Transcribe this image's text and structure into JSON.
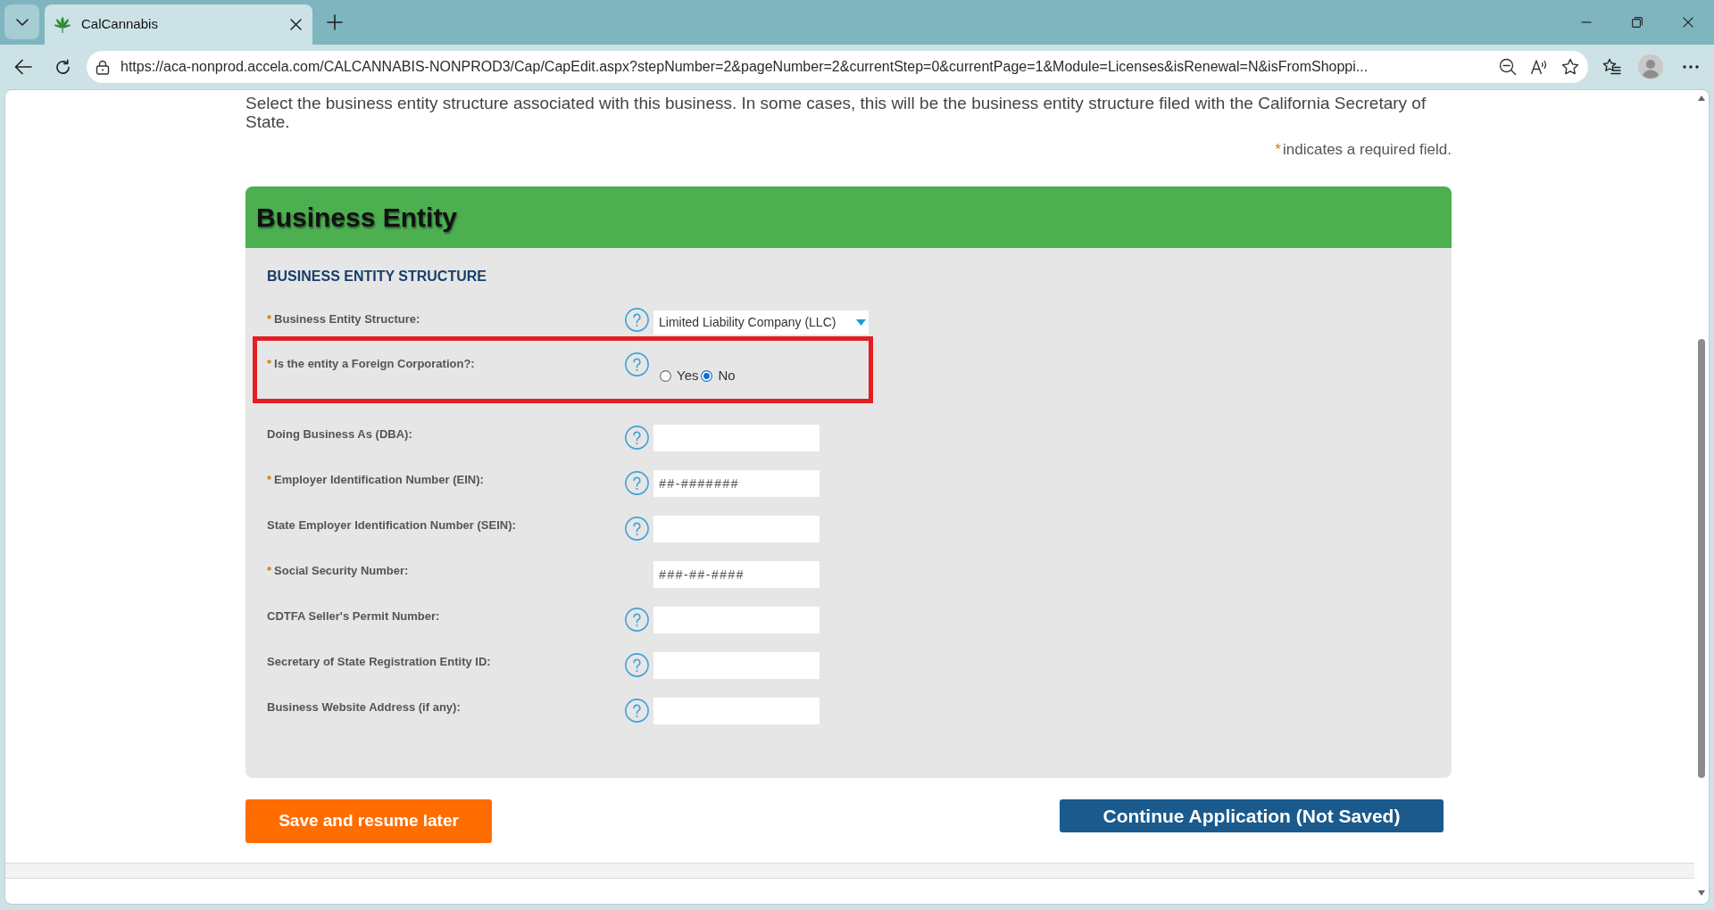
{
  "browser": {
    "tabs": [
      {
        "title": "CalCannabis",
        "selected": true
      }
    ],
    "address": "https://aca-nonprod.accela.com/CALCANNABIS-NONPROD3/Cap/CapEdit.aspx?stepNumber=2&pageNumber=2&currentStep=0&currentPage=1&Module=Licenses&isRenewal=N&isFromShoppi..."
  },
  "page": {
    "intro": "Select the business entity structure associated with this business. In some cases, this will be the business entity structure filed with the California Secretary of State.",
    "required_note": {
      "mark": "*",
      "text": "indicates a required field."
    },
    "section": {
      "title": "Business Entity",
      "subsection": "BUSINESS ENTITY STRUCTURE",
      "fields": [
        {
          "kind": "select",
          "mark": "*",
          "label": "Business Entity Structure:",
          "help": true,
          "highlighted": false,
          "value": "Limited Liability Company (LLC)"
        },
        {
          "kind": "radio",
          "mark": "*",
          "label": "Is the entity a Foreign Corporation?:",
          "help": true,
          "highlighted": true,
          "options": [
            {
              "label": "Yes",
              "selected": false
            },
            {
              "label": "No",
              "selected": true
            }
          ]
        },
        {
          "kind": "text",
          "label": "Doing Business As (DBA):",
          "help": true,
          "highlighted": false
        },
        {
          "kind": "text",
          "mark": "*",
          "label": "Employer Identification Number (EIN):",
          "help": true,
          "highlighted": false,
          "placeholder": "##-#######"
        },
        {
          "kind": "text",
          "label": "State Employer Identification Number (SEIN):",
          "help": true,
          "highlighted": false
        },
        {
          "kind": "text",
          "mark": "*",
          "label": "Social Security Number:",
          "help": false,
          "highlighted": false,
          "placeholder": "###-##-####"
        },
        {
          "kind": "text",
          "label": "CDTFA Seller's Permit Number:",
          "help": true,
          "highlighted": false
        },
        {
          "kind": "text",
          "label": "Secretary of State Registration Entity ID:",
          "help": true,
          "highlighted": false
        },
        {
          "kind": "text",
          "label": "Business Website Address (if any):",
          "help": true,
          "highlighted": false
        }
      ]
    },
    "buttons": [
      {
        "label": "Save and resume later",
        "kind": "secondary"
      },
      {
        "label": "Continue Application (Not Saved)",
        "kind": "primary"
      }
    ]
  }
}
